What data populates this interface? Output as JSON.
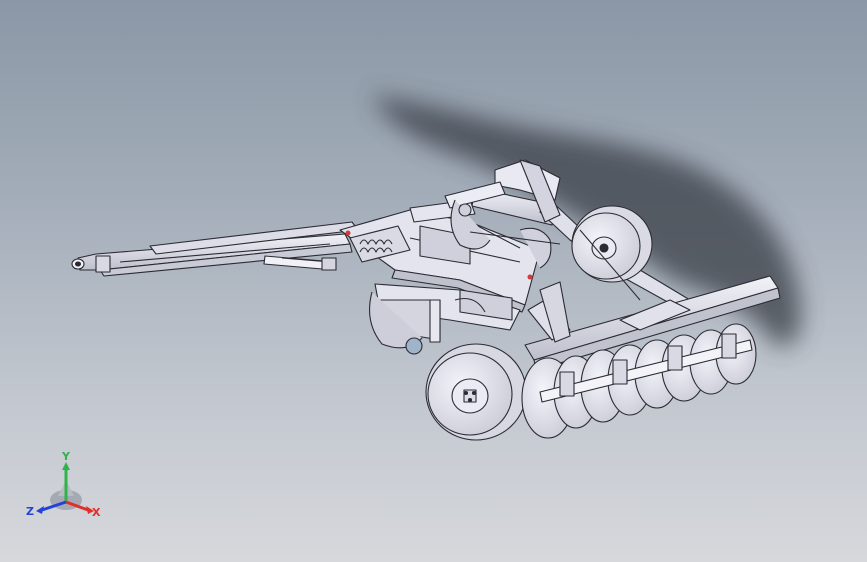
{
  "viewport": {
    "background_top": "#8b97a6",
    "background_bottom": "#d6d8dc",
    "model_color": "#e6e7ef",
    "edge_color": "#2b2b33",
    "shadow_color": "#4a4f58"
  },
  "model": {
    "icon": "disc-harrow-model"
  },
  "triad": {
    "x_label": "X",
    "y_label": "Y",
    "z_label": "Z",
    "x_color": "#e0302a",
    "y_color": "#2fb34a",
    "z_color": "#2442d6"
  }
}
